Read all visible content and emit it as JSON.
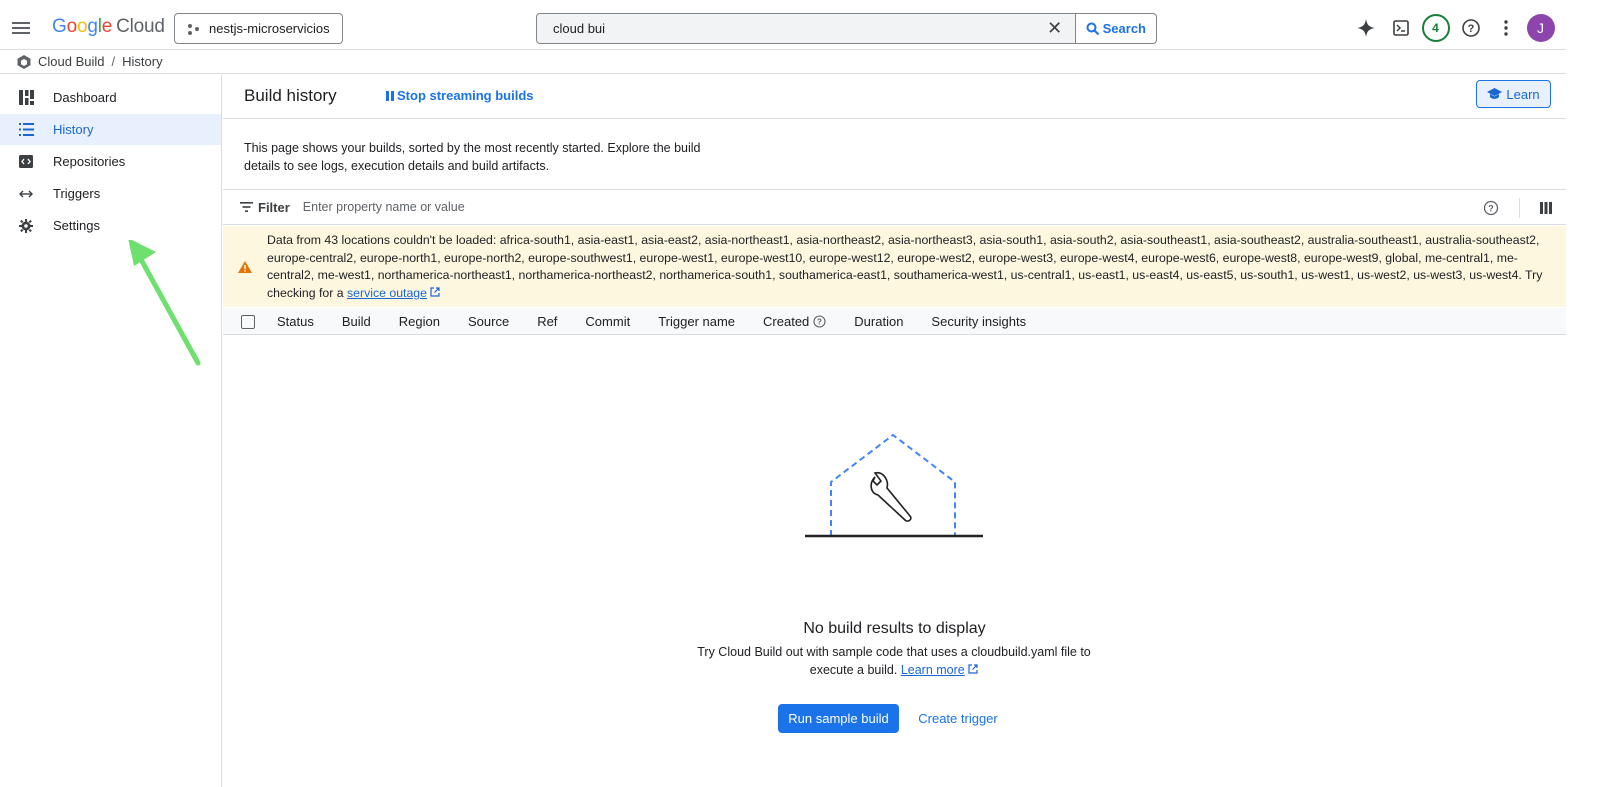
{
  "topbar": {
    "logo_letters": [
      "G",
      "o",
      "o",
      "g",
      "l",
      "e"
    ],
    "logo_product": "Cloud",
    "project_name": "nestjs-microservicios",
    "search_value": "cloud bui",
    "search_button": "Search",
    "notification_count": "4",
    "avatar_initial": "J"
  },
  "breadcrumb": {
    "product": "Cloud Build",
    "page": "History"
  },
  "sidebar": {
    "items": [
      {
        "label": "Dashboard",
        "icon": "dashboard-icon"
      },
      {
        "label": "History",
        "icon": "history-list-icon"
      },
      {
        "label": "Repositories",
        "icon": "repositories-icon"
      },
      {
        "label": "Triggers",
        "icon": "triggers-icon"
      },
      {
        "label": "Settings",
        "icon": "settings-gear-icon"
      }
    ],
    "active_index": 1
  },
  "main": {
    "title": "Build history",
    "stream_label": "Stop streaming builds",
    "learn_label": "Learn",
    "description": "This page shows your builds, sorted by the most recently started. Explore the build details to see logs, execution details and build artifacts.",
    "filter": {
      "label": "Filter",
      "placeholder": "Enter property name or value"
    },
    "warning": {
      "text": "Data from 43 locations couldn't be loaded: africa-south1, asia-east1, asia-east2, asia-northeast1, asia-northeast2, asia-northeast3, asia-south1, asia-south2, asia-southeast1, asia-southeast2, australia-southeast1, australia-southeast2, europe-central2, europe-north1, europe-north2, europe-southwest1, europe-west1, europe-west10, europe-west12, europe-west2, europe-west3, europe-west4, europe-west6, europe-west8, europe-west9, global, me-central1, me-central2, me-west1, northamerica-northeast1, northamerica-northeast2, northamerica-south1, southamerica-east1, southamerica-west1, us-central1, us-east1, us-east4, us-east5, us-south1, us-west1, us-west2, us-west3, us-west4. Try checking for a",
      "link": "service outage"
    },
    "table_columns": [
      "Status",
      "Build",
      "Region",
      "Source",
      "Ref",
      "Commit",
      "Trigger name",
      "Created",
      "Duration",
      "Security insights"
    ],
    "empty": {
      "title": "No build results to display",
      "subtitle": "Try Cloud Build out with sample code that uses a cloudbuild.yaml file to execute a build.",
      "learn_more": "Learn more",
      "primary_button": "Run sample build",
      "secondary_button": "Create trigger"
    }
  },
  "colors": {
    "accent": "#1a73e8",
    "active_nav_bg": "#e8f0fe",
    "warning_bg": "#fef7e0",
    "warning_icon": "#e37400",
    "annotation_arrow": "#6ee06e"
  }
}
